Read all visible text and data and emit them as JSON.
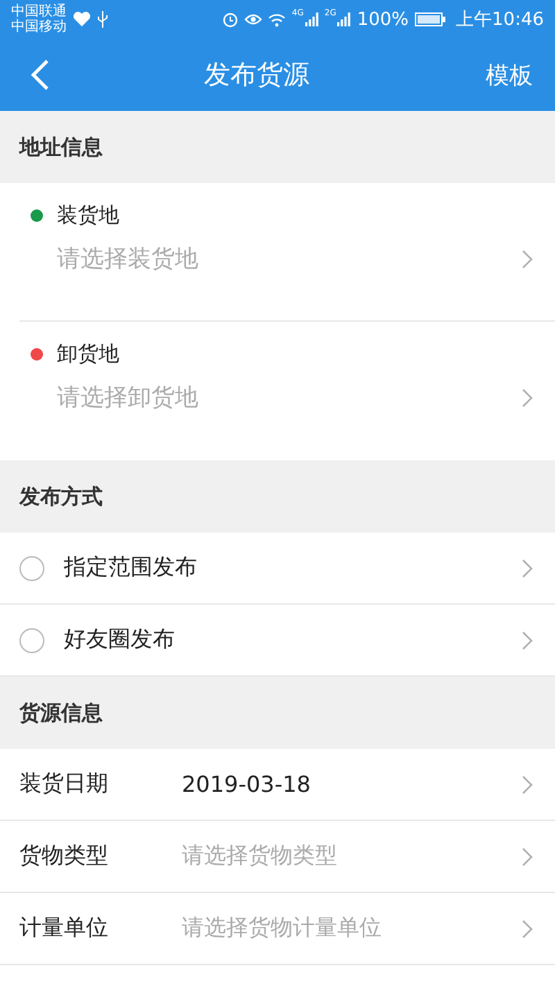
{
  "status_bar": {
    "carriers": [
      "中国联通",
      "中国移动"
    ],
    "network_labels": [
      "4G",
      "2G"
    ],
    "battery": "100%",
    "time": "上午10:46"
  },
  "nav": {
    "title": "发布货源",
    "action": "模板"
  },
  "address_section": {
    "title": "地址信息",
    "items": [
      {
        "label": "装货地",
        "placeholder": "请选择装货地",
        "color": "#1a9a4a"
      },
      {
        "label": "卸货地",
        "placeholder": "请选择卸货地",
        "color": "#f04848"
      }
    ]
  },
  "publish_section": {
    "title": "发布方式",
    "options": [
      {
        "label": "指定范围发布",
        "selected": false
      },
      {
        "label": "好友圈发布",
        "selected": false
      }
    ]
  },
  "cargo_section": {
    "title": "货源信息",
    "fields": [
      {
        "label": "装货日期",
        "value": "2019-03-18"
      },
      {
        "label": "货物类型",
        "placeholder": "请选择货物类型"
      },
      {
        "label": "计量单位",
        "placeholder": "请选择货物计量单位"
      }
    ]
  }
}
